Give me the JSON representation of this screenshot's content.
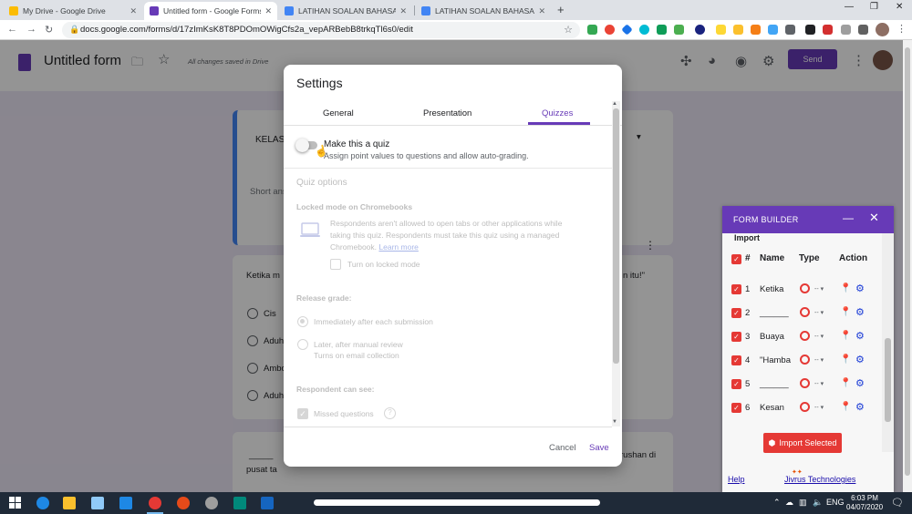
{
  "browser": {
    "tabs": [
      {
        "title": "My Drive - Google Drive",
        "fav": "#4285f4"
      },
      {
        "title": "Untitled form - Google Forms",
        "fav": "#673ab7"
      },
      {
        "title": "LATIHAN SOALAN BAHASA MEL",
        "fav": "#4285f4"
      },
      {
        "title": "LATIHAN SOALAN BAHASA MEL",
        "fav": "#4285f4"
      }
    ],
    "close_glyph": "✕",
    "new_tab_glyph": "+",
    "url": "docs.google.com/forms/d/17zImKsK8T8PDOmOWigCfs2a_vepARBebB8trkqTl6s0/edit"
  },
  "forms": {
    "title": "Untitled form",
    "saved_status": "All changes saved in Drive",
    "send_label": "Send",
    "header_card": {
      "title_prefix": "KELAS",
      "short_answer": "Short answ"
    },
    "question_card": {
      "text_start": "Ketika m",
      "text_end": "n itu!\"",
      "options": [
        "Cis",
        "Aduh",
        "Ambo",
        "Aduh"
      ]
    },
    "third_card": {
      "text_start": "_____",
      "text_end": "rushan di",
      "line2": "pusat ta"
    }
  },
  "form_builder": {
    "title": "FORM BUILDER",
    "import_label": "Import",
    "columns": {
      "check": "#",
      "name": "Name",
      "type": "Type",
      "action": "Action"
    },
    "rows": [
      {
        "num": "1",
        "name": "Ketika"
      },
      {
        "num": "2",
        "name": "______"
      },
      {
        "num": "3",
        "name": "Buaya"
      },
      {
        "num": "4",
        "name": "\"Hamba"
      },
      {
        "num": "5",
        "name": "______"
      },
      {
        "num": "6",
        "name": "Kesan"
      }
    ],
    "type_selector": "-- ▾",
    "import_button": "Import Selected",
    "help": "Help",
    "brand": "Jivrus Technologies",
    "brand_logo_text": "Jivrus"
  },
  "settings": {
    "title": "Settings",
    "tabs": [
      "General",
      "Presentation",
      "Quizzes"
    ],
    "active_tab": "Quizzes",
    "make_quiz": {
      "label": "Make this a quiz",
      "description": "Assign point values to questions and allow auto-grading.",
      "enabled": false
    },
    "quiz_options": {
      "heading": "Quiz options",
      "locked_mode": {
        "heading": "Locked mode on Chromebooks",
        "line1": "Respondents aren't allowed to open tabs or other applications while",
        "line2": "taking this quiz. Respondents must take this quiz using a managed",
        "line3": "Chromebook.",
        "learn_more": "Learn more",
        "checkbox_label": "Turn on locked mode"
      },
      "release_grade": {
        "heading": "Release grade:",
        "option1": "Immediately after each submission",
        "option2": "Later, after manual review",
        "option2_sub": "Turns on email collection"
      },
      "respondent_can_see": {
        "heading": "Respondent can see:",
        "missed_questions": "Missed questions"
      }
    },
    "cancel": "Cancel",
    "save": "Save"
  },
  "taskbar": {
    "language": "ENG",
    "time": "6:03 PM",
    "date": "04/07/2020"
  }
}
